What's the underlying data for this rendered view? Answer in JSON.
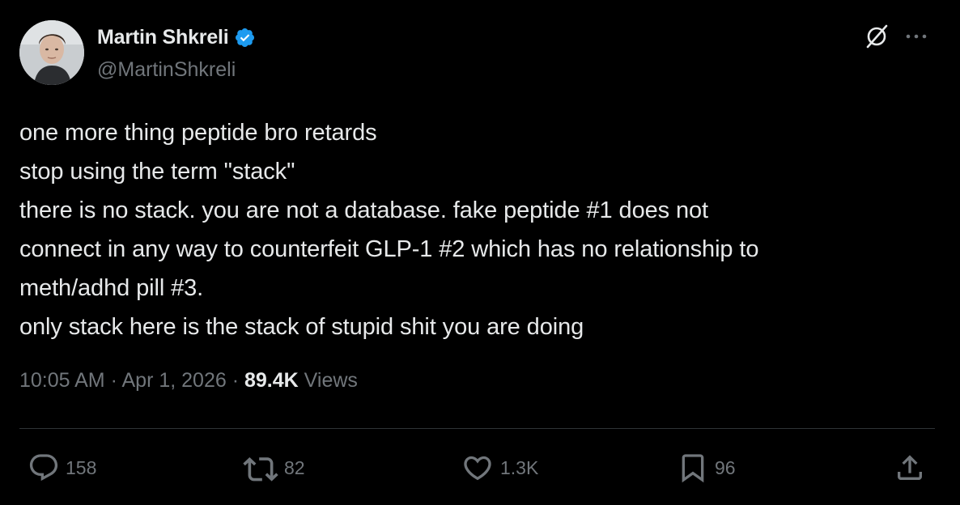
{
  "author": {
    "display_name": "Martin Shkreli",
    "handle": "@MartinShkreli",
    "verified": true,
    "verified_color": "#1d9bf0"
  },
  "tweet": {
    "lines": [
      "one more thing peptide bro retards",
      "stop using the term \"stack\"",
      "there is no stack. you are not a database. fake peptide #1 does not",
      "connect in any way to counterfeit GLP-1 #2 which has no relationship to",
      "meth/adhd pill #3.",
      "only stack here is the stack of stupid shit you are doing"
    ]
  },
  "meta": {
    "time": "10:05 AM",
    "separator": "·",
    "date": "Apr 1, 2026",
    "views_count": "89.4K",
    "views_label": "Views"
  },
  "actions": {
    "replies": "158",
    "reposts": "82",
    "likes": "1.3K",
    "bookmarks": "96"
  },
  "icons": {
    "header": [
      "grok-icon",
      "more-icon"
    ],
    "actions": [
      "reply-icon",
      "repost-icon",
      "like-icon",
      "bookmark-icon",
      "share-icon"
    ]
  },
  "colors": {
    "background": "#000000",
    "text": "#e7e9ea",
    "secondary": "#71767b",
    "divider": "#2f3336"
  }
}
